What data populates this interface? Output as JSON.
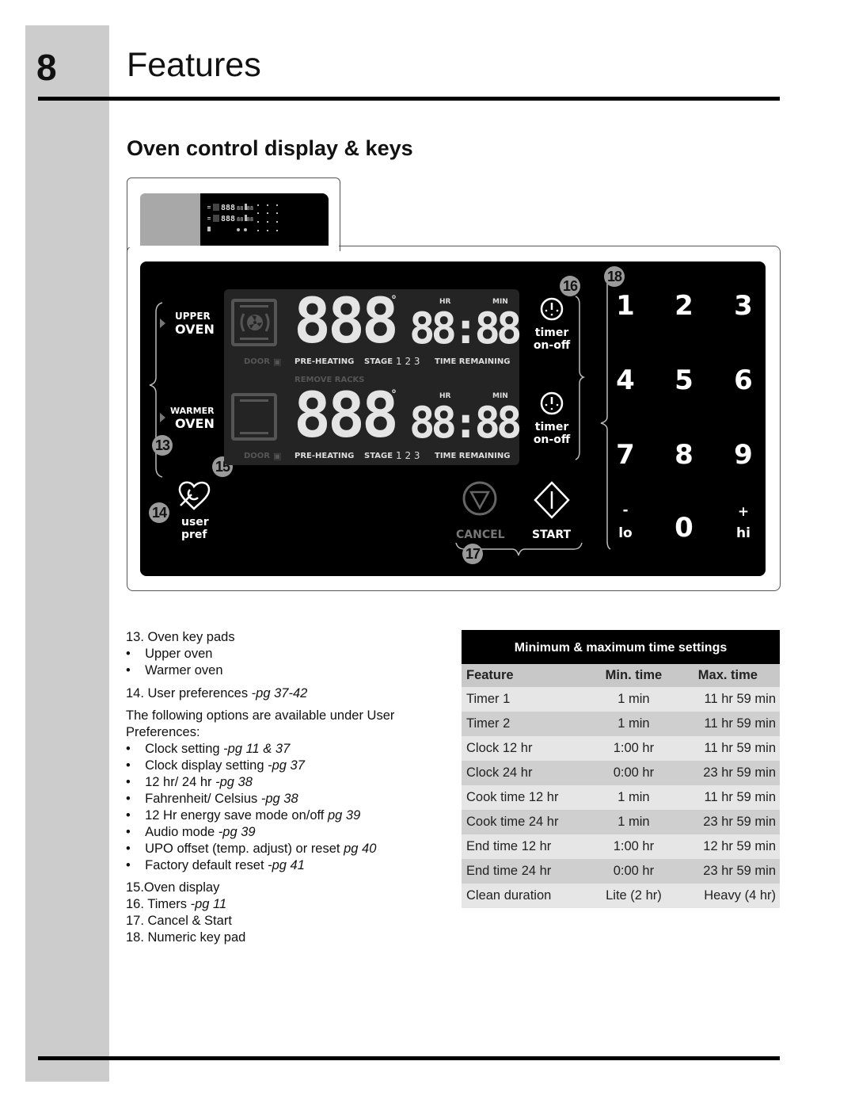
{
  "header": {
    "chapter_number": "8",
    "chapter_title": "Features",
    "section_title": "Oven control display & keys"
  },
  "control_panel": {
    "upper_oven": {
      "line1": "UPPER",
      "line2": "OVEN"
    },
    "warmer_oven": {
      "line1": "WARMER",
      "line2": "OVEN"
    },
    "user_pref": {
      "line1": "user",
      "line2": "pref"
    },
    "display": {
      "upper": {
        "temp": "888",
        "degree": "°",
        "time": "88:88",
        "hr": "HR",
        "min": "MIN",
        "door": "DOOR",
        "preheating": "PRE-HEATING",
        "stage": "STAGE",
        "stage_nums": "1  2  3",
        "time_remaining": "TIME REMAINING"
      },
      "remove_racks": "REMOVE RACKS",
      "lower": {
        "temp": "888",
        "degree": "°",
        "time": "88:88",
        "hr": "HR",
        "min": "MIN",
        "door": "DOOR",
        "preheating": "PRE-HEATING",
        "stage": "STAGE",
        "stage_nums": "1  2  3",
        "time_remaining": "TIME REMAINING"
      }
    },
    "timers": [
      {
        "line1": "timer",
        "line2": "on-off"
      },
      {
        "line1": "timer",
        "line2": "on-off"
      }
    ],
    "cancel_label": "CANCEL",
    "start_label": "START",
    "keypad": [
      "1",
      "2",
      "3",
      "4",
      "5",
      "6",
      "7",
      "8",
      "9"
    ],
    "lo": {
      "sign": "-",
      "label": "lo"
    },
    "zero": "0",
    "hi": {
      "sign": "+",
      "label": "hi"
    },
    "callouts": {
      "c13": "13",
      "c14": "14",
      "c15": "15",
      "c16": "16",
      "c17": "17",
      "c18": "18"
    }
  },
  "legend": {
    "item13": "13. Oven key pads",
    "item13_bullets": [
      "Upper oven",
      "Warmer oven"
    ],
    "item14_text": "14. User preferences ",
    "item14_ref": "-pg 37-42",
    "intro_line1": "The following options are available under User",
    "intro_line2": "Preferences:",
    "options": [
      {
        "text": "Clock setting ",
        "ref": "-pg 11 & 37"
      },
      {
        "text": "Clock display setting ",
        "ref": "-pg 37"
      },
      {
        "text": "12 hr/ 24 hr ",
        "ref": "-pg 38"
      },
      {
        "text": "Fahrenheit/ Celsius ",
        "ref": "-pg 38"
      },
      {
        "text": "12 Hr energy save mode on/off ",
        "ref": "pg 39"
      },
      {
        "text": "Audio mode ",
        "ref": "-pg 39"
      },
      {
        "text": "UPO offset (temp. adjust) or reset ",
        "ref": "pg 40"
      },
      {
        "text": "Factory default reset ",
        "ref": "-pg 41"
      }
    ],
    "item15": "15.Oven display",
    "item16_text": "16. Timers ",
    "item16_ref": "-pg 11",
    "item17": "17. Cancel & Start",
    "item18": "18. Numeric key pad"
  },
  "time_table": {
    "caption": "Minimum & maximum time settings",
    "headers": [
      "Feature",
      "Min. time",
      "Max. time"
    ],
    "rows": [
      [
        "Timer 1",
        "1 min",
        "11 hr 59 min"
      ],
      [
        "Timer 2",
        "1 min",
        "11 hr 59 min"
      ],
      [
        "Clock 12 hr",
        "1:00 hr",
        "11 hr 59 min"
      ],
      [
        "Clock 24 hr",
        "0:00 hr",
        "23 hr 59 min"
      ],
      [
        "Cook time 12 hr",
        "1 min",
        "11 hr 59 min"
      ],
      [
        "Cook time 24 hr",
        "1 min",
        "23 hr 59 min"
      ],
      [
        "End time 12 hr",
        "1:00 hr",
        "12 hr 59 min"
      ],
      [
        "End time 24 hr",
        "0:00 hr",
        "23 hr 59 min"
      ],
      [
        "Clean duration",
        "Lite (2 hr)",
        "Heavy (4 hr)"
      ]
    ]
  }
}
